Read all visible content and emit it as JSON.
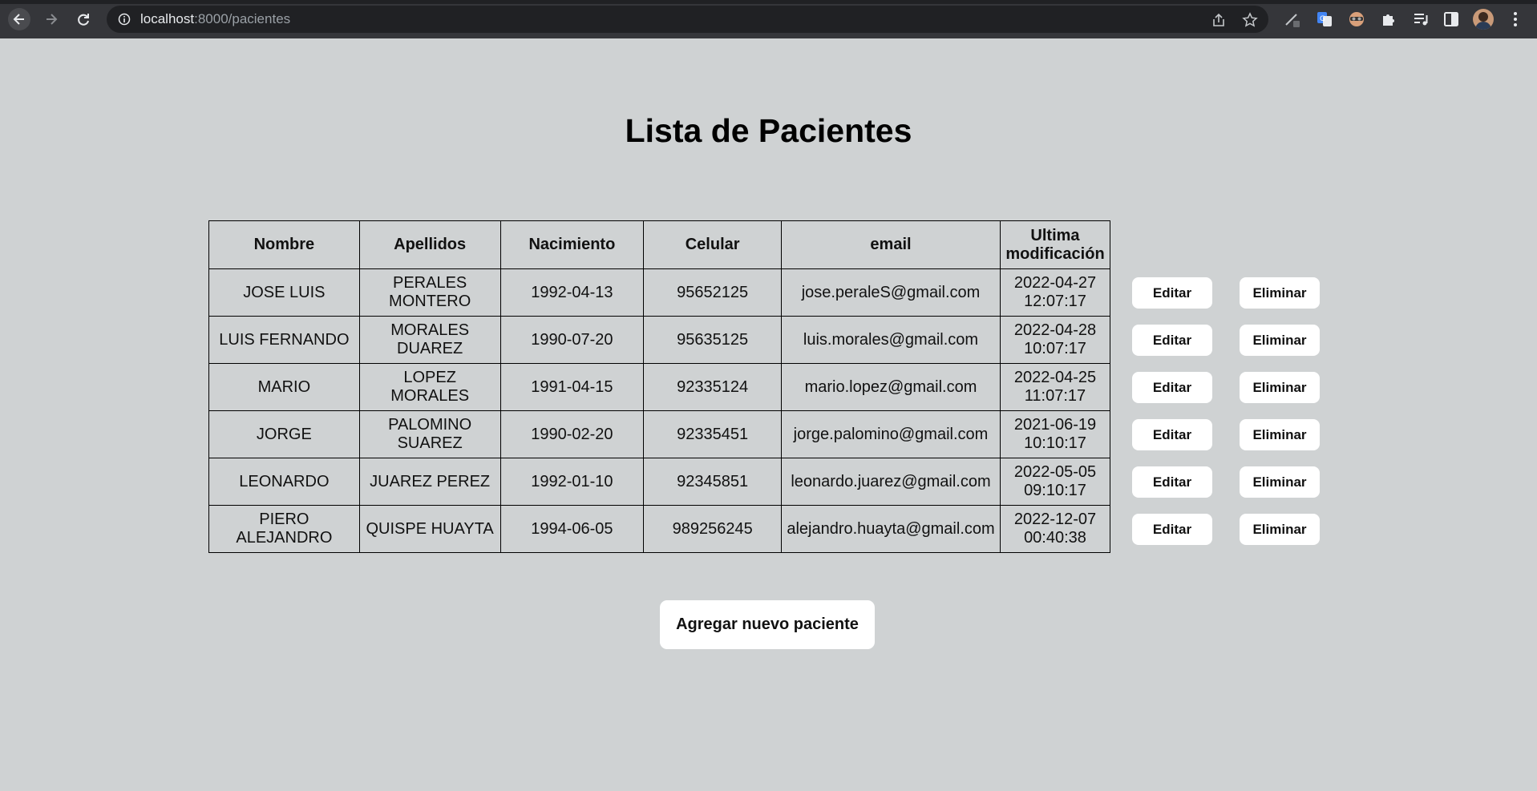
{
  "browser": {
    "url_host": "localhost",
    "url_path": ":8000/pacientes"
  },
  "page": {
    "title": "Lista de Pacientes"
  },
  "table": {
    "headers": {
      "nombre": "Nombre",
      "apellidos": "Apellidos",
      "nacimiento": "Nacimiento",
      "celular": "Celular",
      "email": "email",
      "ultima_1": "Ultima",
      "ultima_2": "modificación"
    },
    "rows": [
      {
        "nombre": "JOSE LUIS",
        "apellidos": "PERALES MONTERO",
        "nacimiento": "1992-04-13",
        "celular": "95652125",
        "email": "jose.peraleS@gmail.com",
        "fecha": "2022-04-27",
        "hora": "12:07:17"
      },
      {
        "nombre": "LUIS FERNANDO",
        "apellidos": "MORALES DUAREZ",
        "nacimiento": "1990-07-20",
        "celular": "95635125",
        "email": "luis.morales@gmail.com",
        "fecha": "2022-04-28",
        "hora": "10:07:17"
      },
      {
        "nombre": "MARIO",
        "apellidos": "LOPEZ MORALES",
        "nacimiento": "1991-04-15",
        "celular": "92335124",
        "email": "mario.lopez@gmail.com",
        "fecha": "2022-04-25",
        "hora": "11:07:17"
      },
      {
        "nombre": "JORGE",
        "apellidos": "PALOMINO SUAREZ",
        "nacimiento": "1990-02-20",
        "celular": "92335451",
        "email": "jorge.palomino@gmail.com",
        "fecha": "2021-06-19",
        "hora": "10:10:17"
      },
      {
        "nombre": "LEONARDO",
        "apellidos": "JUAREZ PEREZ",
        "nacimiento": "1992-01-10",
        "celular": "92345851",
        "email": "leonardo.juarez@gmail.com",
        "fecha": "2022-05-05",
        "hora": "09:10:17"
      },
      {
        "nombre": "PIERO ALEJANDRO",
        "apellidos": "QUISPE HUAYTA",
        "nacimiento": "1994-06-05",
        "celular": "989256245",
        "email": "alejandro.huayta@gmail.com",
        "fecha": "2022-12-07",
        "hora": "00:40:38"
      }
    ]
  },
  "actions": {
    "edit_label": "Editar",
    "delete_label": "Eliminar",
    "add_label": "Agregar nuevo paciente"
  }
}
